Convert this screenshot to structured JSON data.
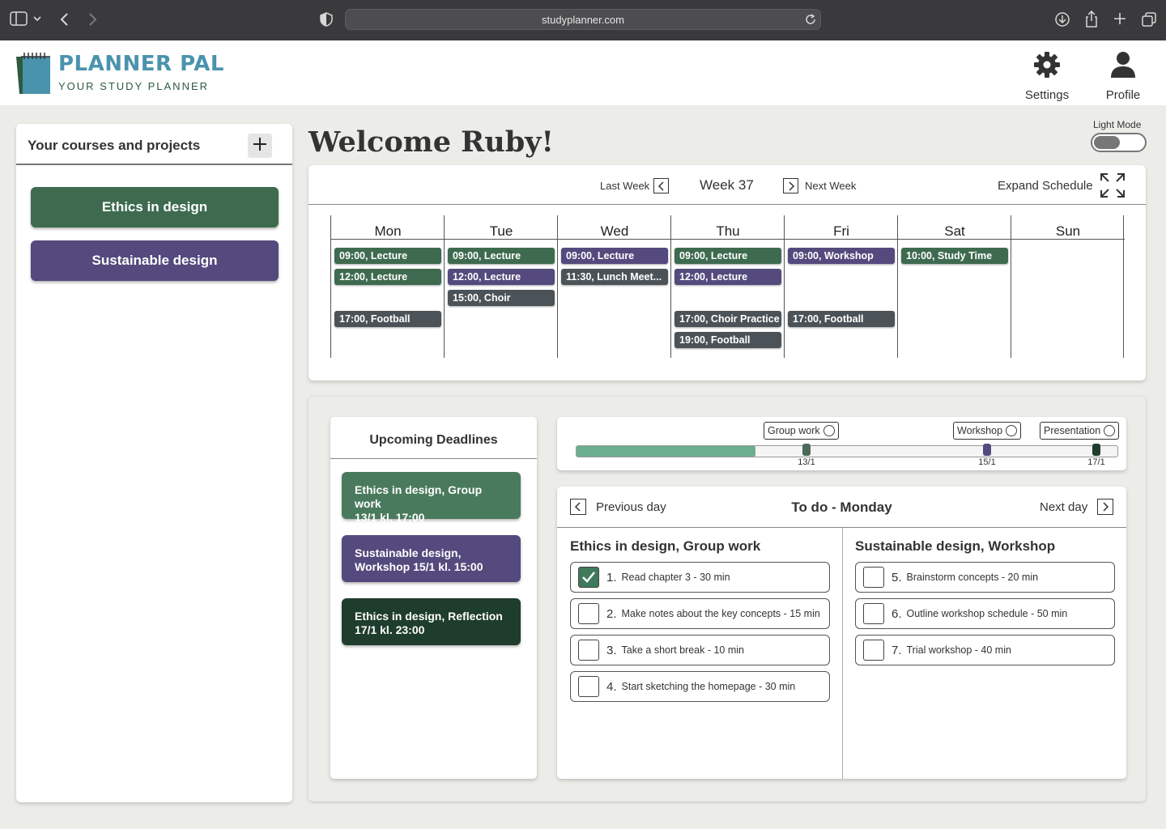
{
  "browser": {
    "url": "studyplanner.com"
  },
  "app": {
    "title": "PLANNER PAL",
    "subtitle": "YOUR STUDY PLANNER"
  },
  "header": {
    "settings_label": "Settings",
    "profile_label": "Profile"
  },
  "sidebar": {
    "title": "Your courses and projects",
    "add_icon": "plus-icon",
    "courses": [
      {
        "label": "Ethics in design",
        "color": "#3e6b4f"
      },
      {
        "label": "Sustainable design",
        "color": "#544a7d"
      }
    ]
  },
  "welcome": "Welcome Ruby!",
  "mode": {
    "label": "Light Mode",
    "enabled": false
  },
  "schedule": {
    "last_week": "Last Week",
    "week": "Week 37",
    "next_week": "Next Week",
    "expand": "Expand Schedule",
    "days": [
      {
        "name": "Mon",
        "events": [
          {
            "text": "09:00, Lecture",
            "kind": "ethics"
          },
          {
            "text": "12:00, Lecture",
            "kind": "ethics"
          },
          {
            "text": "17:00, Football",
            "kind": "other"
          }
        ]
      },
      {
        "name": "Tue",
        "events": [
          {
            "text": "09:00, Lecture",
            "kind": "ethics"
          },
          {
            "text": "12:00, Lecture",
            "kind": "sustain"
          },
          {
            "text": "15:00, Choir",
            "kind": "other"
          }
        ]
      },
      {
        "name": "Wed",
        "events": [
          {
            "text": "09:00, Lecture",
            "kind": "sustain"
          },
          {
            "text": "11:30, Lunch Meet...",
            "kind": "other"
          }
        ]
      },
      {
        "name": "Thu",
        "events": [
          {
            "text": "09:00, Lecture",
            "kind": "ethics"
          },
          {
            "text": "12:00, Lecture",
            "kind": "sustain"
          },
          {
            "text": "17:00, Choir Practice",
            "kind": "other"
          },
          {
            "text": "19:00, Football",
            "kind": "other"
          }
        ]
      },
      {
        "name": "Fri",
        "events": [
          {
            "text": "09:00, Workshop",
            "kind": "sustain"
          },
          {
            "text": "17:00, Football",
            "kind": "other"
          }
        ]
      },
      {
        "name": "Sat",
        "events": [
          {
            "text": "10:00, Study Time",
            "kind": "ethics"
          }
        ]
      },
      {
        "name": "Sun",
        "events": []
      }
    ],
    "colors": {
      "ethics": "#3e6b4f",
      "sustain": "#544a7d",
      "other": "#4c5358"
    }
  },
  "deadlines": {
    "title": "Upcoming Deadlines",
    "items": [
      {
        "line1": "Ethics in design, Group work",
        "line2": "13/1 kl. 17:00",
        "color": "#4a7a5d"
      },
      {
        "line1": "Sustainable design,",
        "line2": "Workshop 15/1 kl. 15:00",
        "color": "#544a7d"
      },
      {
        "line1": "Ethics in design, Reflection",
        "line2": "17/1 kl. 23:00",
        "color": "#1f3d2c"
      }
    ]
  },
  "progress": {
    "fraction": 0.33,
    "milestones": [
      {
        "label": "Group work",
        "date": "13/1",
        "color": "#4c6a5a"
      },
      {
        "label": "Workshop",
        "date": "15/1",
        "color": "#544a7d"
      },
      {
        "label": "Presentation",
        "date": "17/1",
        "color": "#1f3d2c"
      }
    ]
  },
  "todo": {
    "title": "To do - Monday",
    "previous": "Previous day",
    "next": "Next day",
    "groups": [
      {
        "title": "Ethics in design, Group work",
        "tasks": [
          {
            "num": "1.",
            "text": "Read chapter 3 - 30 min",
            "done": true
          },
          {
            "num": "2.",
            "text": "Make notes about the key concepts - 15 min",
            "done": false
          },
          {
            "num": "3.",
            "text": "Take a short break - 10 min",
            "done": false
          },
          {
            "num": "4.",
            "text": "Start sketching the homepage - 30 min",
            "done": false
          }
        ]
      },
      {
        "title": "Sustainable design, Workshop",
        "tasks": [
          {
            "num": "5.",
            "text": "Brainstorm concepts - 20 min",
            "done": false
          },
          {
            "num": "6.",
            "text": "Outline workshop schedule - 50 min",
            "done": false
          },
          {
            "num": "7.",
            "text": "Trial workshop - 40 min",
            "done": false
          }
        ]
      }
    ]
  }
}
